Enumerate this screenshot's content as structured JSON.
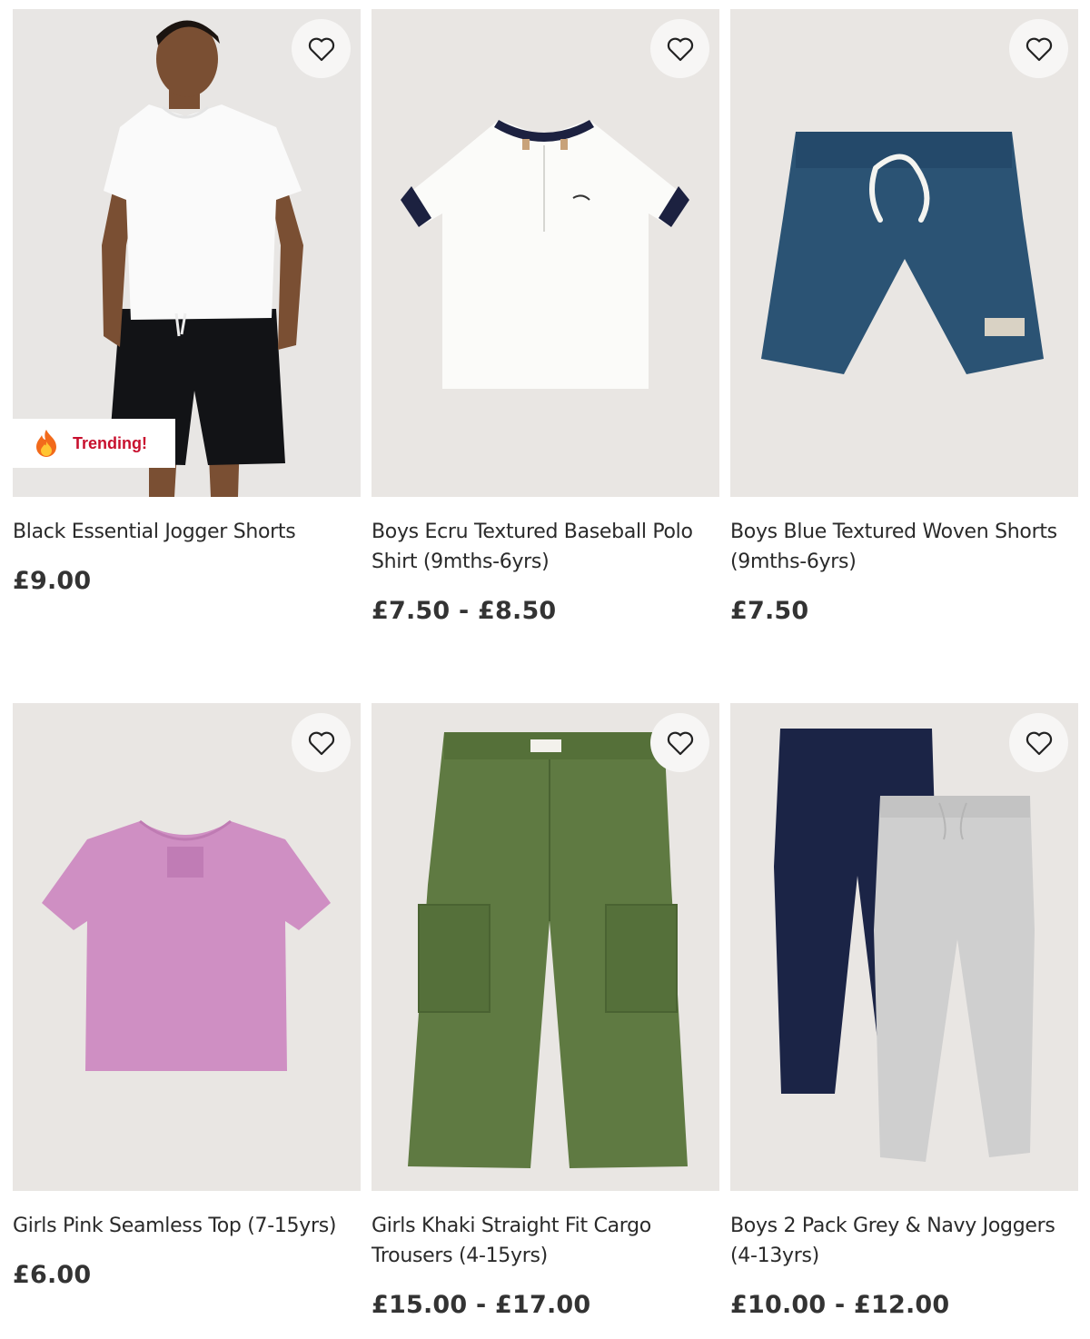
{
  "products": [
    {
      "title": "Black Essential Jogger Shorts",
      "price": "£9.00",
      "badge": "Trending!",
      "icon": "heart-icon"
    },
    {
      "title": "Boys Ecru Textured Baseball Polo Shirt (9mths-6yrs)",
      "price": "£7.50 - £8.50",
      "icon": "heart-icon"
    },
    {
      "title": "Boys Blue Textured Woven Shorts (9mths-6yrs)",
      "price": "£7.50",
      "icon": "heart-icon"
    },
    {
      "title": "Girls Pink Seamless Top (7-15yrs)",
      "price": "£6.00",
      "icon": "heart-icon"
    },
    {
      "title": "Girls Khaki Straight Fit Cargo Trousers (4-15yrs)",
      "price": "£15.00 - £17.00",
      "icon": "heart-icon"
    },
    {
      "title": "Boys 2 Pack Grey & Navy Joggers (4-13yrs)",
      "price": "£10.00 - £12.00",
      "icon": "heart-icon"
    }
  ],
  "colors": {
    "badge_text": "#c8102e",
    "image_bg": "#e9e6e3",
    "price": "#333333"
  }
}
